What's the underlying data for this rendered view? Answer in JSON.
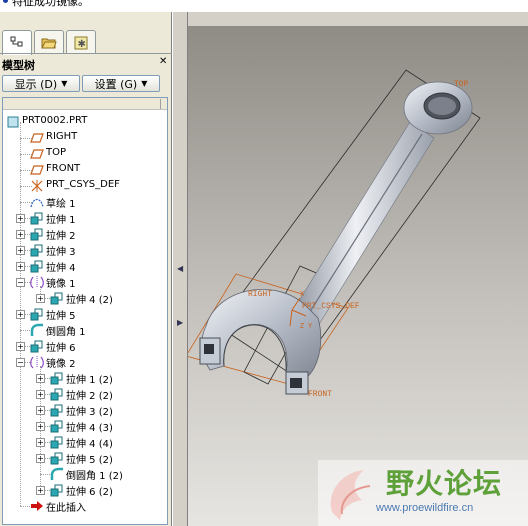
{
  "message": {
    "text": "特征成功镜像。"
  },
  "panel": {
    "title": "模型树",
    "close": "✕",
    "show_button": "显示 (D)",
    "settings_button": "设置 (G)",
    "tabs": [
      "model-tree",
      "folder-browser",
      "favorites"
    ]
  },
  "tree": {
    "items": [
      {
        "label": "PRT0002.PRT",
        "icon": "part-icon",
        "expander": ""
      },
      {
        "label": "RIGHT",
        "icon": "datum-plane-icon",
        "expander": ""
      },
      {
        "label": "TOP",
        "icon": "datum-plane-icon",
        "expander": ""
      },
      {
        "label": "FRONT",
        "icon": "datum-plane-icon",
        "expander": ""
      },
      {
        "label": "PRT_CSYS_DEF",
        "icon": "csys-icon",
        "expander": ""
      },
      {
        "label": "草绘 1",
        "icon": "sketch-icon",
        "expander": ""
      },
      {
        "label": "拉伸 1",
        "icon": "extrude-icon",
        "expander": "+"
      },
      {
        "label": "拉伸 2",
        "icon": "extrude-icon",
        "expander": "+"
      },
      {
        "label": "拉伸 3",
        "icon": "extrude-icon",
        "expander": "+"
      },
      {
        "label": "拉伸 4",
        "icon": "extrude-icon",
        "expander": "+"
      },
      {
        "label": "镜像 1",
        "icon": "mirror-icon",
        "expander": "−"
      },
      {
        "label": "拉伸 4 (2)",
        "icon": "extrude-icon",
        "expander": "+"
      },
      {
        "label": "拉伸 5",
        "icon": "extrude-icon",
        "expander": "+"
      },
      {
        "label": "倒圆角 1",
        "icon": "round-icon",
        "expander": ""
      },
      {
        "label": "拉伸 6",
        "icon": "extrude-icon",
        "expander": "+"
      },
      {
        "label": "镜像 2",
        "icon": "mirror-icon",
        "expander": "−"
      },
      {
        "label": "拉伸 1 (2)",
        "icon": "extrude-icon",
        "expander": "+"
      },
      {
        "label": "拉伸 2 (2)",
        "icon": "extrude-icon",
        "expander": "+"
      },
      {
        "label": "拉伸 3 (2)",
        "icon": "extrude-icon",
        "expander": "+"
      },
      {
        "label": "拉伸 4 (3)",
        "icon": "extrude-icon",
        "expander": "+"
      },
      {
        "label": "拉伸 4 (4)",
        "icon": "extrude-icon",
        "expander": "+"
      },
      {
        "label": "拉伸 5 (2)",
        "icon": "extrude-icon",
        "expander": "+"
      },
      {
        "label": "倒圆角 1 (2)",
        "icon": "round-icon",
        "expander": ""
      },
      {
        "label": "拉伸 6 (2)",
        "icon": "extrude-icon",
        "expander": "+"
      },
      {
        "label": "在此插入",
        "icon": "insert-here-arrow-icon",
        "expander": ""
      }
    ]
  },
  "viewport": {
    "labels": {
      "top": "TOP",
      "right": "RIGHT",
      "csys": "PRT_CSYS_DEF",
      "front": "FRONT",
      "axis_x": "X",
      "axis_y": "Y",
      "axis_z": "Z"
    }
  },
  "watermark": {
    "title": "野火论坛",
    "url": "www.proewildfire.cn"
  },
  "colors": {
    "accent_blue": "#1a3fa6",
    "datum_orange": "#c8621c",
    "extrude_teal": "#2aa7b0",
    "mirror_purple": "#8a46c4",
    "insert_red": "#cc1111"
  }
}
